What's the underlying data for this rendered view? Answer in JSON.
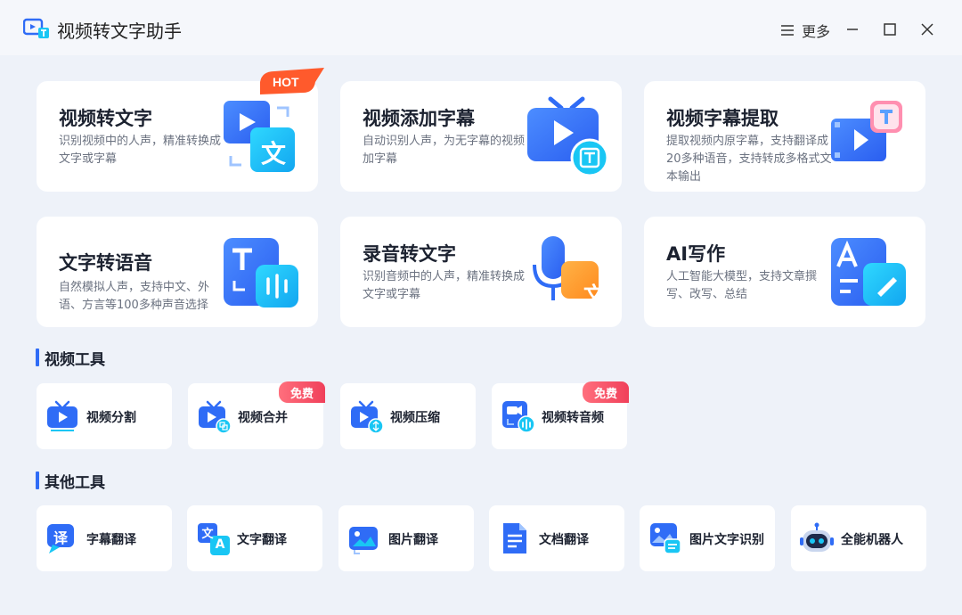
{
  "app": {
    "title": "视频转文字助手",
    "more_label": "更多"
  },
  "cards": [
    {
      "title": "视频转文字",
      "desc": "识别视频中的人声，精准转换成文字或字幕",
      "badge": "HOT"
    },
    {
      "title": "视频添加字幕",
      "desc": "自动识别人声，为无字幕的视频加字幕"
    },
    {
      "title": "视频字幕提取",
      "desc": "提取视频内原字幕，支持翻译成20多种语音，支持转成多格式文本输出"
    },
    {
      "title": "文字转语音",
      "desc": "自然模拟人声，支持中文、外语、方言等100多种声音选择"
    },
    {
      "title": "录音转文字",
      "desc": "识别音频中的人声，精准转换成文字或字幕"
    },
    {
      "title": "AI写作",
      "desc": "人工智能大模型，支持文章撰写、改写、总结"
    }
  ],
  "video_tools": {
    "heading": "视频工具",
    "items": [
      {
        "label": "视频分割"
      },
      {
        "label": "视频合并",
        "badge": "免费"
      },
      {
        "label": "视频压缩"
      },
      {
        "label": "视频转音频",
        "badge": "免费"
      }
    ]
  },
  "other_tools": {
    "heading": "其他工具",
    "items": [
      {
        "label": "字幕翻译"
      },
      {
        "label": "文字翻译"
      },
      {
        "label": "图片翻译"
      },
      {
        "label": "文档翻译"
      },
      {
        "label": "图片文字识别"
      },
      {
        "label": "全能机器人"
      }
    ]
  },
  "icon_glyphs": {
    "translate_char": "译",
    "wen_char": "文",
    "a_char": "A",
    "t_char": "T"
  },
  "colors": {
    "accent": "#2f6cf6",
    "hot": "#ff4b2b",
    "free": "#f0405a",
    "cyan": "#19c6f4",
    "orange": "#ff9a2e"
  }
}
